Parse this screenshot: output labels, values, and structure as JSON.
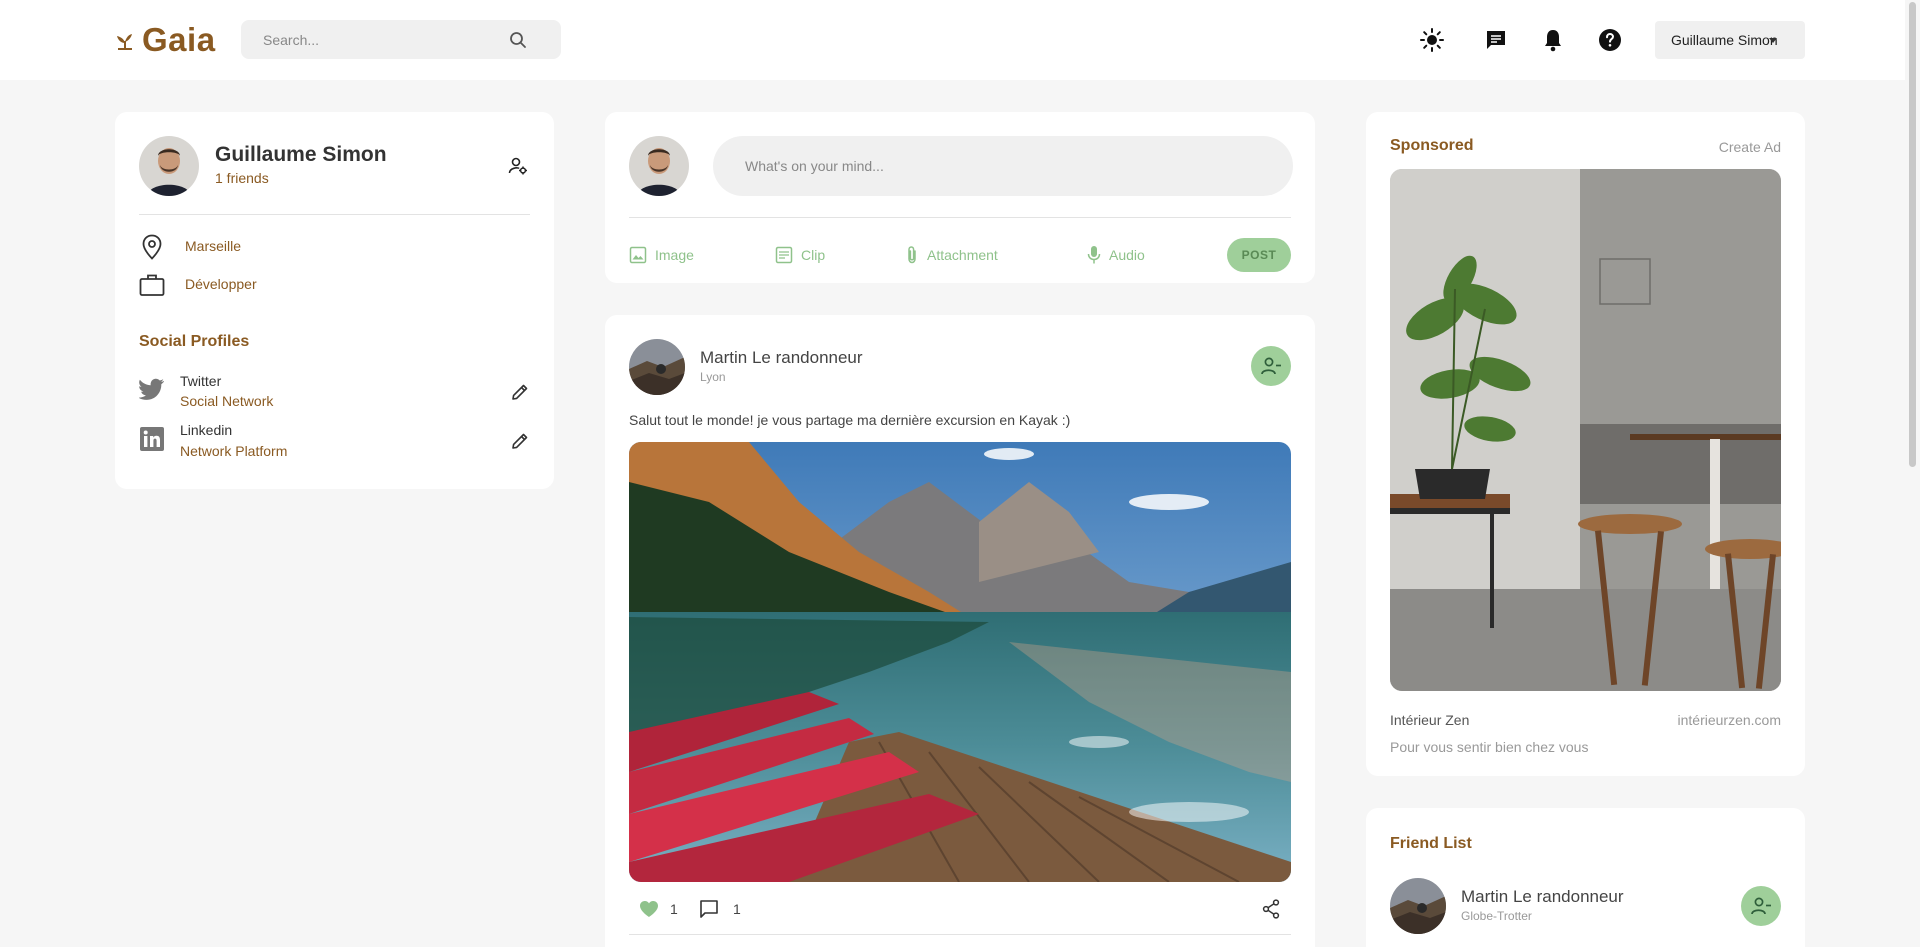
{
  "brand": {
    "name": "Gaia",
    "icon": "sprout-icon"
  },
  "search": {
    "placeholder": "Search..."
  },
  "navbar": {
    "icons": [
      "sun-icon",
      "message-icon",
      "bell-icon",
      "help-icon"
    ],
    "user_menu": "Guillaume Simon"
  },
  "profile": {
    "name": "Guillaume Simon",
    "friends": "1 friends",
    "location": "Marseille",
    "occupation": "Développer",
    "social_title": "Social Profiles",
    "socials": [
      {
        "name": "Twitter",
        "sub": "Social Network"
      },
      {
        "name": "Linkedin",
        "sub": "Network Platform"
      }
    ]
  },
  "composer": {
    "placeholder": "What's on your mind...",
    "options": [
      "Image",
      "Clip",
      "Attachment",
      "Audio"
    ],
    "post_label": "POST"
  },
  "post": {
    "author": "Martin Le randonneur",
    "location": "Lyon",
    "text": "Salut tout le monde! je vous partage ma dernière excursion en Kayak :)",
    "likes": "1",
    "comments": "1"
  },
  "sponsored": {
    "title": "Sponsored",
    "create_ad": "Create Ad",
    "ad_name": "Intérieur Zen",
    "ad_site": "intérieurzen.com",
    "ad_desc": "Pour vous sentir bien chez vous"
  },
  "friend_list": {
    "title": "Friend List",
    "friends": [
      {
        "name": "Martin Le randonneur",
        "sub": "Globe-Trotter"
      }
    ]
  },
  "colors": {
    "accent": "#8a5a22",
    "green": "#9fcf9a",
    "background": "#f6f6f6"
  }
}
